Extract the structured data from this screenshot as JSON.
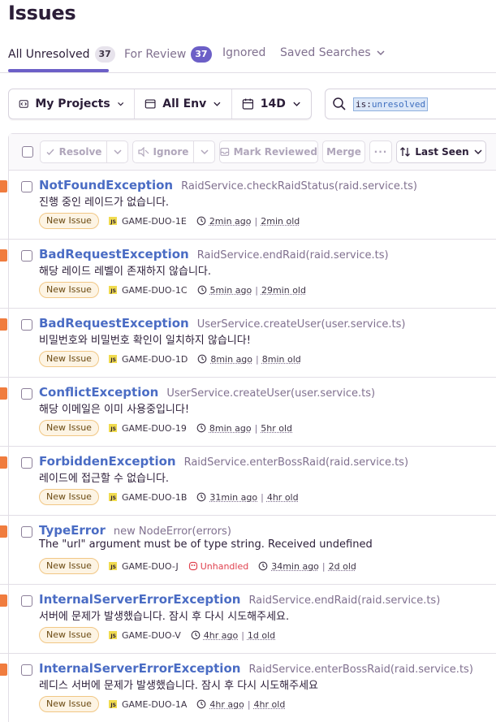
{
  "page": {
    "title": "Issues"
  },
  "tabs": [
    {
      "label": "All Unresolved",
      "count": "37"
    },
    {
      "label": "For Review",
      "count": "37"
    },
    {
      "label": "Ignored"
    },
    {
      "label": "Saved Searches"
    }
  ],
  "filters": {
    "projects": "My Projects",
    "environment": "All Env",
    "period": "14D"
  },
  "search": {
    "token_key": "is:",
    "token_value": "unresolved"
  },
  "actions": {
    "resolve": "Resolve",
    "ignore": "Ignore",
    "mark_reviewed": "Mark Reviewed",
    "merge": "Merge",
    "more": "···",
    "sort": "Last Seen"
  },
  "issues": [
    {
      "type": "NotFoundException",
      "location": "RaidService.checkRaidStatus(raid.service.ts)",
      "message": "진행 중인 레이드가 없습니다.",
      "badge": "New Issue",
      "short_id": "GAME-DUO-1E",
      "last_seen": "2min ago",
      "first_seen": "2min old"
    },
    {
      "type": "BadRequestException",
      "location": "RaidService.endRaid(raid.service.ts)",
      "message": "해당 레이드 레벨이 존재하지 않습니다.",
      "badge": "New Issue",
      "short_id": "GAME-DUO-1C",
      "last_seen": "5min ago",
      "first_seen": "29min old"
    },
    {
      "type": "BadRequestException",
      "location": "UserService.createUser(user.service.ts)",
      "message": "비밀번호와 비밀번호 확인이 일치하지 않습니다!",
      "badge": "New Issue",
      "short_id": "GAME-DUO-1D",
      "last_seen": "8min ago",
      "first_seen": "8min old"
    },
    {
      "type": "ConflictException",
      "location": "UserService.createUser(user.service.ts)",
      "message": "해당 이메일은 이미 사용중입니다!",
      "badge": "New Issue",
      "short_id": "GAME-DUO-19",
      "last_seen": "8min ago",
      "first_seen": "5hr old"
    },
    {
      "type": "ForbiddenException",
      "location": "RaidService.enterBossRaid(raid.service.ts)",
      "message": "레이드에 접근할 수 없습니다.",
      "badge": "New Issue",
      "short_id": "GAME-DUO-1B",
      "last_seen": "31min ago",
      "first_seen": "4hr old"
    },
    {
      "type": "TypeError",
      "location": "new NodeError(errors)",
      "message": "The \"url\" argument must be of type string. Received undefined",
      "badge": "New Issue",
      "short_id": "GAME-DUO-J",
      "unhandled": "Unhandled",
      "last_seen": "34min ago",
      "first_seen": "2d old"
    },
    {
      "type": "InternalServerErrorException",
      "location": "RaidService.endRaid(raid.service.ts)",
      "message": "서버에 문제가 발생했습니다. 잠시 후 다시 시도해주세요.",
      "badge": "New Issue",
      "short_id": "GAME-DUO-V",
      "last_seen": "4hr ago",
      "first_seen": "1d old"
    },
    {
      "type": "InternalServerErrorException",
      "location": "RaidService.enterBossRaid(raid.service.ts)",
      "message": "레디스 서버에 문제가 발생했습니다. 잠시 후 다시 시도해주세요",
      "badge": "New Issue",
      "short_id": "GAME-DUO-1A",
      "last_seen": "4hr ago",
      "first_seen": "4hr old"
    }
  ],
  "colors": {
    "accent": "#6c5fc7",
    "link": "#4a6cc4",
    "level_bar": "#f07c3e",
    "unhandled": "#e0424f"
  },
  "icons": [
    "project-icon",
    "calendar-icon",
    "search-icon",
    "check-icon",
    "mute-icon",
    "inbox-icon",
    "sort-icon",
    "clock-icon",
    "js-icon",
    "unhandled-icon",
    "chevron-down-icon"
  ]
}
